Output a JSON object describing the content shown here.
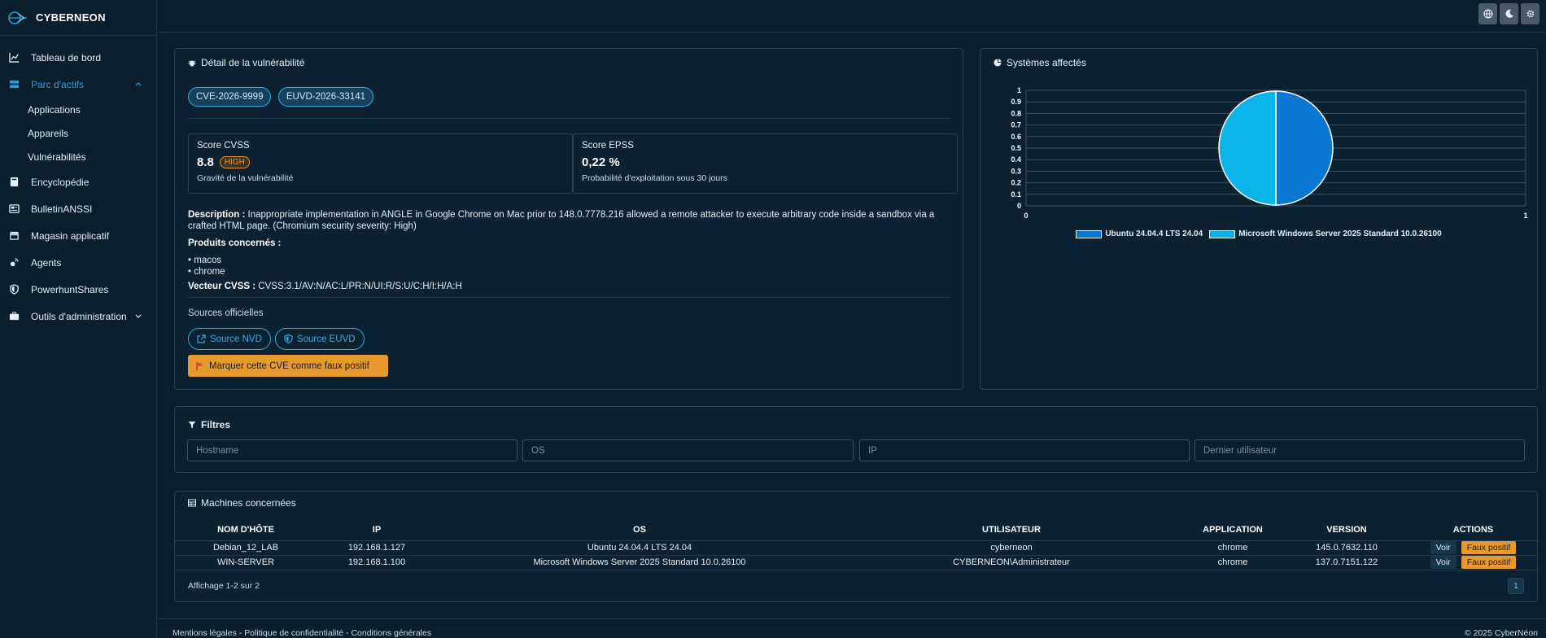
{
  "brand": {
    "name": "CYBERNEON"
  },
  "sidebar": {
    "items": [
      {
        "label": "Tableau de bord",
        "icon": "chart-line-icon"
      },
      {
        "label": "Parc d'actifs",
        "icon": "server-icon",
        "active": true,
        "children": [
          "Applications",
          "Appareils",
          "Vulnérabilités"
        ]
      },
      {
        "label": "Encyclopédie",
        "icon": "book-icon"
      },
      {
        "label": "BulletinANSSI",
        "icon": "newspaper-icon"
      },
      {
        "label": "Magasin applicatif",
        "icon": "store-icon"
      },
      {
        "label": "Agents",
        "icon": "satellite-icon"
      },
      {
        "label": "PowerhuntShares",
        "icon": "shield-icon"
      },
      {
        "label": "Outils d'administration",
        "icon": "briefcase-icon"
      }
    ]
  },
  "detail": {
    "title": "Détail de la vulnérabilité",
    "ids": [
      "CVE-2026-9999",
      "EUVD-2026-33141"
    ],
    "cvss": {
      "label": "Score CVSS",
      "value": "8.8",
      "severity": "HIGH",
      "sub": "Gravité de la vulnérabilité"
    },
    "epss": {
      "label": "Score EPSS",
      "value": "0,22 %",
      "sub": "Probabilité d'exploitation sous 30 jours"
    },
    "description_label": "Description :",
    "description": "Inappropriate implementation in ANGLE in Google Chrome on Mac prior to 148.0.7778.216 allowed a remote attacker to execute arbitrary code inside a sandbox via a crafted HTML page. (Chromium security severity: High)",
    "products_label": "Produits concernés :",
    "products": [
      "macos",
      "chrome"
    ],
    "vector_label": "Vecteur CVSS :",
    "vector": "CVSS:3.1/AV:N/AC:L/PR:N/UI:R/S:U/C:H/I:H/A:H",
    "sources_label": "Sources officielles",
    "source_nvd": "Source NVD",
    "source_euvd": "Source EUVD",
    "false_positive": "Marquer cette CVE comme faux positif"
  },
  "systems": {
    "title": "Systèmes affectés",
    "chart_data": {
      "type": "pie",
      "categories": [
        "Ubuntu 24.04.4 LTS 24.04",
        "Microsoft Windows Server 2025 Standard 10.0.26100"
      ],
      "values": [
        1,
        1
      ],
      "colors": [
        "#0a78d2",
        "#0bb5ea"
      ],
      "y_ticks": [
        "1",
        "0.9",
        "0.8",
        "0.7",
        "0.6",
        "0.5",
        "0.4",
        "0.3",
        "0.2",
        "0.1",
        "0"
      ],
      "x_ticks": [
        "0",
        "1"
      ],
      "legend_position": "bottom"
    }
  },
  "filters": {
    "title": "Filtres",
    "hostname_placeholder": "Hostname",
    "os_placeholder": "OS",
    "ip_placeholder": "IP",
    "user_placeholder": "Dernier utilisateur"
  },
  "machines": {
    "title": "Machines concernées",
    "columns": [
      "NOM D'HÔTE",
      "IP",
      "OS",
      "UTILISATEUR",
      "APPLICATION",
      "VERSION",
      "ACTIONS"
    ],
    "rows": [
      [
        "Debian_12_LAB",
        "192.168.1.127",
        "Ubuntu 24.04.4 LTS 24.04",
        "cyberneon",
        "chrome",
        "145.0.7632.110"
      ],
      [
        "WIN-SERVER",
        "192.168.1.100",
        "Microsoft Windows Server 2025 Standard 10.0.26100",
        "CYBERNEON\\Administrateur",
        "chrome",
        "137.0.7151.122"
      ]
    ],
    "action_view": "Voir",
    "action_fp": "Faux positif",
    "pagination_text": "Affichage 1-2 sur 2",
    "page": "1"
  },
  "footer": {
    "links": "Mentions légales - Politique de confidentialité - Conditions générales",
    "copyright": "© 2025 CyberNéon"
  }
}
